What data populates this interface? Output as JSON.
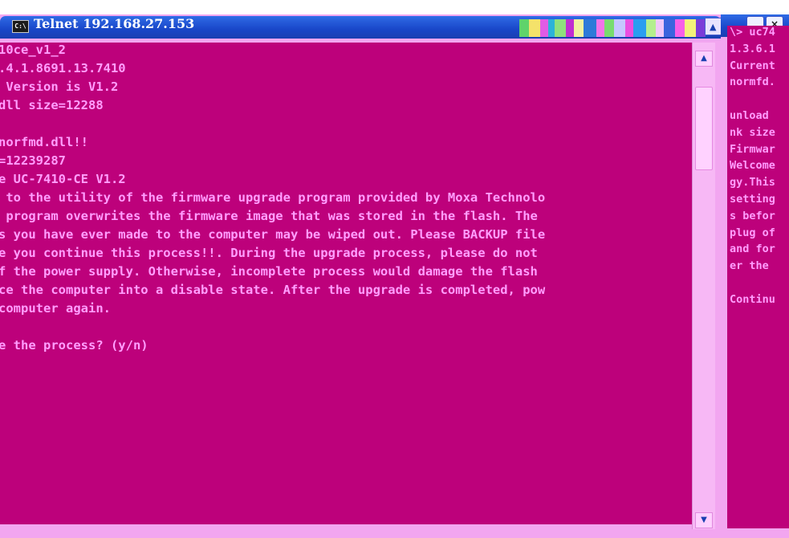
{
  "window": {
    "title": "Telnet 192.168.27.153",
    "icon": "C:\\",
    "console_lines": [
      "10ce_v1_2",
      ".4.1.8691.13.7410",
      " Version is V1.2",
      "dll size=12288",
      "",
      "norfmd.dll!!",
      "=12239287",
      "e UC-7410-CE V1.2",
      " to the utility of the firmware upgrade program provided by Moxa Technolo",
      " program overwrites the firmware image that was stored in the flash. The",
      "s you have ever made to the computer may be wiped out. Please BACKUP file",
      "e you continue this process!!. During the upgrade process, please do not",
      "f the power supply. Otherwise, incomplete process would damage the flash",
      "ce the computer into a disable state. After the upgrade is completed, pow",
      "computer again.",
      "",
      "e the process? (y/n)"
    ]
  },
  "background_window": {
    "buttons": {
      "minimize": "▁",
      "close": "×"
    },
    "console_lines": [
      "\\> uc74",
      "1.3.6.1",
      "Current",
      "normfd.",
      "",
      "unload",
      "nk size",
      "Firmwar",
      "Welcome",
      "gy.This",
      "setting",
      "s befor",
      "plug of",
      "and for",
      "er the",
      "",
      "Continu"
    ]
  },
  "scrollbar": {
    "up": "▲",
    "down": "▼"
  },
  "colors": {
    "console_bg": "#bd017b",
    "console_text": "#ff9eff",
    "frame": "#f2a6f0",
    "titlebar": "#1946c8"
  }
}
